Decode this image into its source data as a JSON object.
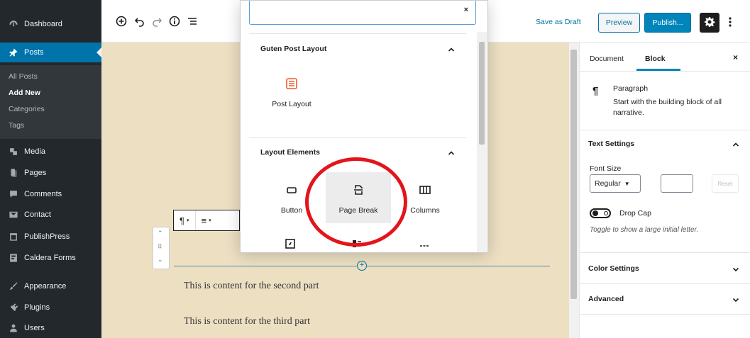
{
  "admin_menu": {
    "items": [
      {
        "label": "Dashboard",
        "icon": "dashboard-icon"
      },
      {
        "label": "Posts",
        "icon": "pin-icon"
      },
      {
        "label": "Media",
        "icon": "media-icon"
      },
      {
        "label": "Pages",
        "icon": "pages-icon"
      },
      {
        "label": "Comments",
        "icon": "comments-icon"
      },
      {
        "label": "Contact",
        "icon": "mail-icon"
      },
      {
        "label": "PublishPress",
        "icon": "calendar-icon"
      },
      {
        "label": "Caldera Forms",
        "icon": "forms-icon"
      },
      {
        "label": "Appearance",
        "icon": "brush-icon"
      },
      {
        "label": "Plugins",
        "icon": "plugin-icon"
      },
      {
        "label": "Users",
        "icon": "users-icon"
      }
    ],
    "submenu": [
      "All Posts",
      "Add New",
      "Categories",
      "Tags"
    ]
  },
  "toolbar": {
    "save_draft": "Save as Draft",
    "preview": "Preview",
    "publish": "Publish...",
    "icons": [
      "add-block-icon",
      "undo-icon",
      "redo-icon",
      "info-icon",
      "outline-icon",
      "gear-icon",
      "more-menu-icon"
    ]
  },
  "inserter": {
    "search_value": "",
    "clear_symbol": "×",
    "panels": [
      {
        "title": "Guten Post Layout",
        "blocks": [
          {
            "label": "Post Layout",
            "icon": "post-layout-icon"
          }
        ]
      },
      {
        "title": "Layout Elements",
        "blocks": [
          {
            "label": "Button",
            "icon": "button-icon"
          },
          {
            "label": "Page Break",
            "icon": "page-break-icon"
          },
          {
            "label": "Columns",
            "icon": "columns-icon"
          }
        ]
      }
    ]
  },
  "editor": {
    "paragraphs": [
      "This is content for the second part",
      "This is content for the third part"
    ],
    "block_toolbar": {
      "paragraph_symbol": "¶",
      "align_symbol": "≡",
      "caret": "▾"
    },
    "mover": {
      "up": "⌃",
      "drag": "⠿",
      "down": "⌄"
    }
  },
  "settings_sidebar": {
    "tabs": [
      "Document",
      "Block"
    ],
    "active_tab": "Block",
    "close_symbol": "×",
    "block_card": {
      "icon_symbol": "¶",
      "title": "Paragraph",
      "description": "Start with the building block of all narrative."
    },
    "text_settings": {
      "title": "Text Settings",
      "font_size_label": "Font Size",
      "font_size_value": "Regular",
      "custom_size_value": "",
      "reset_label": "Reset",
      "drop_cap_label": "Drop Cap",
      "drop_cap_help": "Toggle to show a large initial letter."
    },
    "panels": [
      "Color Settings",
      "Advanced"
    ]
  },
  "colors": {
    "admin_bg": "#23282d",
    "admin_active": "#0073aa",
    "canvas_bg": "#ecdfc2",
    "publish_bg": "#0085ba",
    "highlight": "#e3141b"
  }
}
